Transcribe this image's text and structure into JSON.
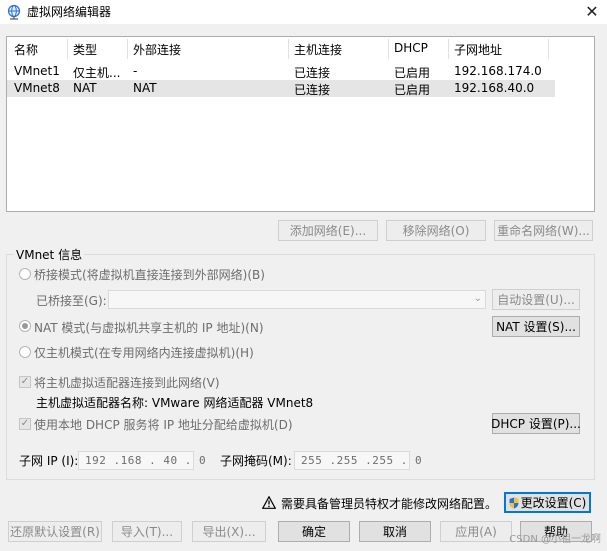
{
  "window": {
    "title": "虚拟网络编辑器",
    "close_glyph": "✕"
  },
  "list": {
    "columns": [
      "名称",
      "类型",
      "外部连接",
      "主机连接",
      "DHCP",
      "子网地址"
    ],
    "rows": [
      {
        "name": "VMnet1",
        "type": "仅主机...",
        "external": "-",
        "host": "已连接",
        "dhcp": "已启用",
        "subnet": "192.168.174.0"
      },
      {
        "name": "VMnet8",
        "type": "NAT",
        "external": "NAT",
        "host": "已连接",
        "dhcp": "已启用",
        "subnet": "192.168.40.0"
      }
    ]
  },
  "list_buttons": {
    "add": "添加网络(E)...",
    "remove": "移除网络(O)",
    "rename": "重命名网络(W)..."
  },
  "vmnet_info": {
    "group_title": "VMnet 信息",
    "bridge_mode": "桥接模式(将虚拟机直接连接到外部网络)(B)",
    "bridged_to": "已桥接至(G):",
    "auto_settings": "自动设置(U)...",
    "nat_mode": "NAT 模式(与虚拟机共享主机的 IP 地址)(N)",
    "nat_settings": "NAT 设置(S)...",
    "host_only_mode": "仅主机模式(在专用网络内连接虚拟机)(H)",
    "connect_adapter": "将主机虚拟适配器连接到此网络(V)",
    "adapter_name": "主机虚拟适配器名称: VMware 网络适配器 VMnet8",
    "use_dhcp": "使用本地 DHCP 服务将 IP 地址分配给虚拟机(D)",
    "dhcp_settings": "DHCP 设置(P)...",
    "subnet_ip_label": "子网 IP (I):",
    "subnet_ip_value": "192 .168 . 40 . 0",
    "subnet_mask_label": "子网掩码(M):",
    "subnet_mask_value": "255 .255 .255 . 0"
  },
  "admin_notice": "需要具备管理员特权才能修改网络配置。",
  "change_settings": "更改设置(C)",
  "footer": {
    "restore_defaults": "还原默认设置(R)",
    "import": "导入(T)...",
    "export": "导出(X)...",
    "ok": "确定",
    "cancel": "取消",
    "apply": "应用(A)",
    "help": "帮助"
  },
  "watermark": "CSDN @小祖一龙啊",
  "colors": {
    "accent": "#0078d7",
    "selected_row": "#e5e5e5",
    "warning": "#000000",
    "shield_blue": "#2a6ed9",
    "shield_yellow": "#f4c430"
  }
}
